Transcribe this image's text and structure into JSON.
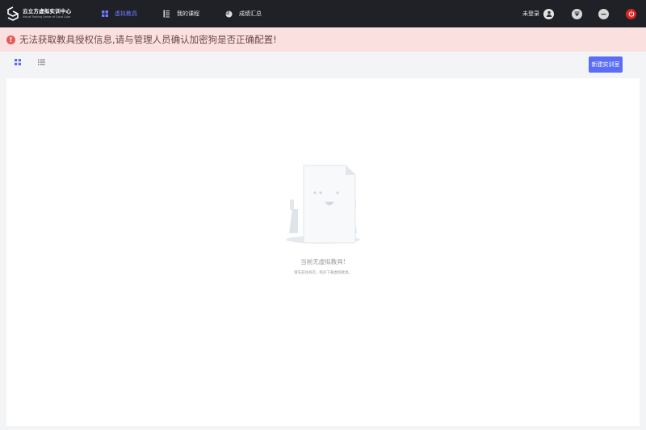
{
  "app": {
    "title": "云立方虚拟实训中心",
    "subtitle": "Virtual Training Center of Cloud Cube"
  },
  "nav": {
    "items": [
      {
        "label": "虚拟教具",
        "icon": "grid-icon",
        "active": true
      },
      {
        "label": "我的课程",
        "icon": "course-icon",
        "active": false
      },
      {
        "label": "成绩汇总",
        "icon": "pie-chart-icon",
        "active": false
      }
    ]
  },
  "header": {
    "login_status": "未登录"
  },
  "alert": {
    "message": "无法获取教具授权信息,请与管理人员确认加密狗是否正确配置!",
    "color": "#e25b5b"
  },
  "toolbar": {
    "new_button": "新建实训室"
  },
  "empty": {
    "title": "当前无虚拟教具!",
    "subtitle": "请先前往商店，购买下载虚拟教具。"
  },
  "colors": {
    "accent": "#5b6cf5",
    "topbar": "#1f2126",
    "power": "#e02424"
  }
}
